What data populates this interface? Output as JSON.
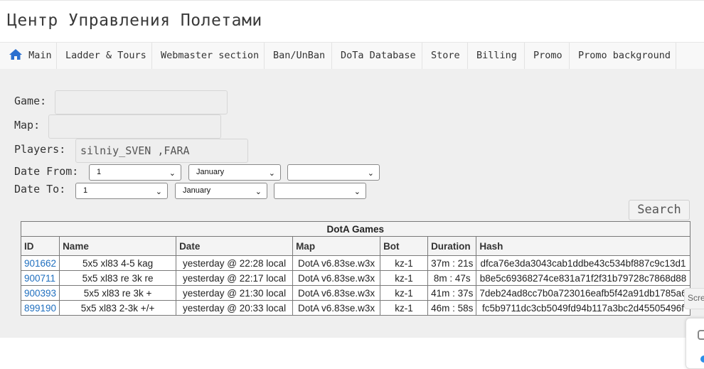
{
  "header": {
    "title": "Центр Управления Полетами"
  },
  "nav": {
    "items": [
      {
        "label": "Main",
        "icon": "home-icon"
      },
      {
        "label": "Ladder & Tours"
      },
      {
        "label": "Webmaster section"
      },
      {
        "label": "Ban/UnBan"
      },
      {
        "label": "DoTa Database"
      },
      {
        "label": "Store"
      },
      {
        "label": "Billing"
      },
      {
        "label": "Promo"
      },
      {
        "label": "Promo background"
      }
    ]
  },
  "filters": {
    "game_label": "Game:",
    "game_value": "",
    "map_label": "Map:",
    "map_value": "",
    "players_label": "Players:",
    "players_value": "silniy_SVEN ,FARA",
    "date_from_label": "Date From:",
    "date_from": {
      "day": "1",
      "month": "January",
      "year": ""
    },
    "date_to_label": "Date To:",
    "date_to": {
      "day": "1",
      "month": "January",
      "year": ""
    },
    "search_label": "Search"
  },
  "games_table": {
    "caption": "DotA Games",
    "columns": [
      "ID",
      "Name",
      "Date",
      "Map",
      "Bot",
      "Duration",
      "Hash"
    ],
    "rows": [
      [
        "901662",
        "5x5 xl83 4-5 kag",
        "yesterday @ 22:28 local",
        "DotA v6.83se.w3x",
        "kz-1",
        "37m : 21s",
        "dfca76e3da3043cab1ddbe43c534bf887c9c13d1"
      ],
      [
        "900711",
        "5x5 xl83 re 3k re",
        "yesterday @ 22:17 local",
        "DotA v6.83se.w3x",
        "kz-1",
        "8m : 47s",
        "b8e5c69368274ce831a71f2f31b79728c7868d88"
      ],
      [
        "900393",
        "5x5 xl83 re 3k +",
        "yesterday @ 21:30 local",
        "DotA v6.83se.w3x",
        "kz-1",
        "41m : 37s",
        "7deb24ad8cc7b0a723016eafb5f42a91db1785a6"
      ],
      [
        "899190",
        "5x5 xl83 2-3k +/+",
        "yesterday @ 20:33 local",
        "DotA v6.83se.w3x",
        "kz-1",
        "46m : 58s",
        "fc5b9711dc3cb5049fd94b117a3bc2d45505496f"
      ]
    ]
  },
  "side": {
    "tab_label": "Scre"
  },
  "colors": {
    "link": "#1f6fbf",
    "nav_icon": "#2a6fcf",
    "panel_bg": "#efefef"
  }
}
